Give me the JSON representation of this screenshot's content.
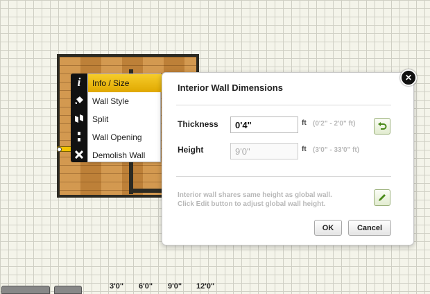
{
  "context_menu": {
    "items": [
      {
        "label": "Info / Size",
        "icon": "info-icon",
        "active": true
      },
      {
        "label": "Wall Style",
        "icon": "paint-bucket-icon",
        "active": false
      },
      {
        "label": "Split",
        "icon": "split-icon",
        "active": false
      },
      {
        "label": "Wall Opening",
        "icon": "wall-opening-icon",
        "active": false
      },
      {
        "label": "Demolish Wall",
        "icon": "close-icon",
        "active": false
      }
    ],
    "active_color": "#e8b400"
  },
  "dialog": {
    "title": "Interior Wall Dimensions",
    "thickness": {
      "label": "Thickness",
      "value": "0'4\"",
      "unit": "ft",
      "range": "(0'2\" - 2'0\" ft)"
    },
    "height": {
      "label": "Height",
      "value": "9'0\"",
      "unit": "ft",
      "range": "(3'0\" - 33'0\" ft)"
    },
    "note_line1": "Interior wall shares same height as global wall.",
    "note_line2": "Click Edit button to adjust global wall height.",
    "ok_label": "OK",
    "cancel_label": "Cancel",
    "close_glyph": "✕"
  },
  "ruler": {
    "labels": [
      "3'0\"",
      "6'0\"",
      "9'0\"",
      "12'0\""
    ]
  }
}
